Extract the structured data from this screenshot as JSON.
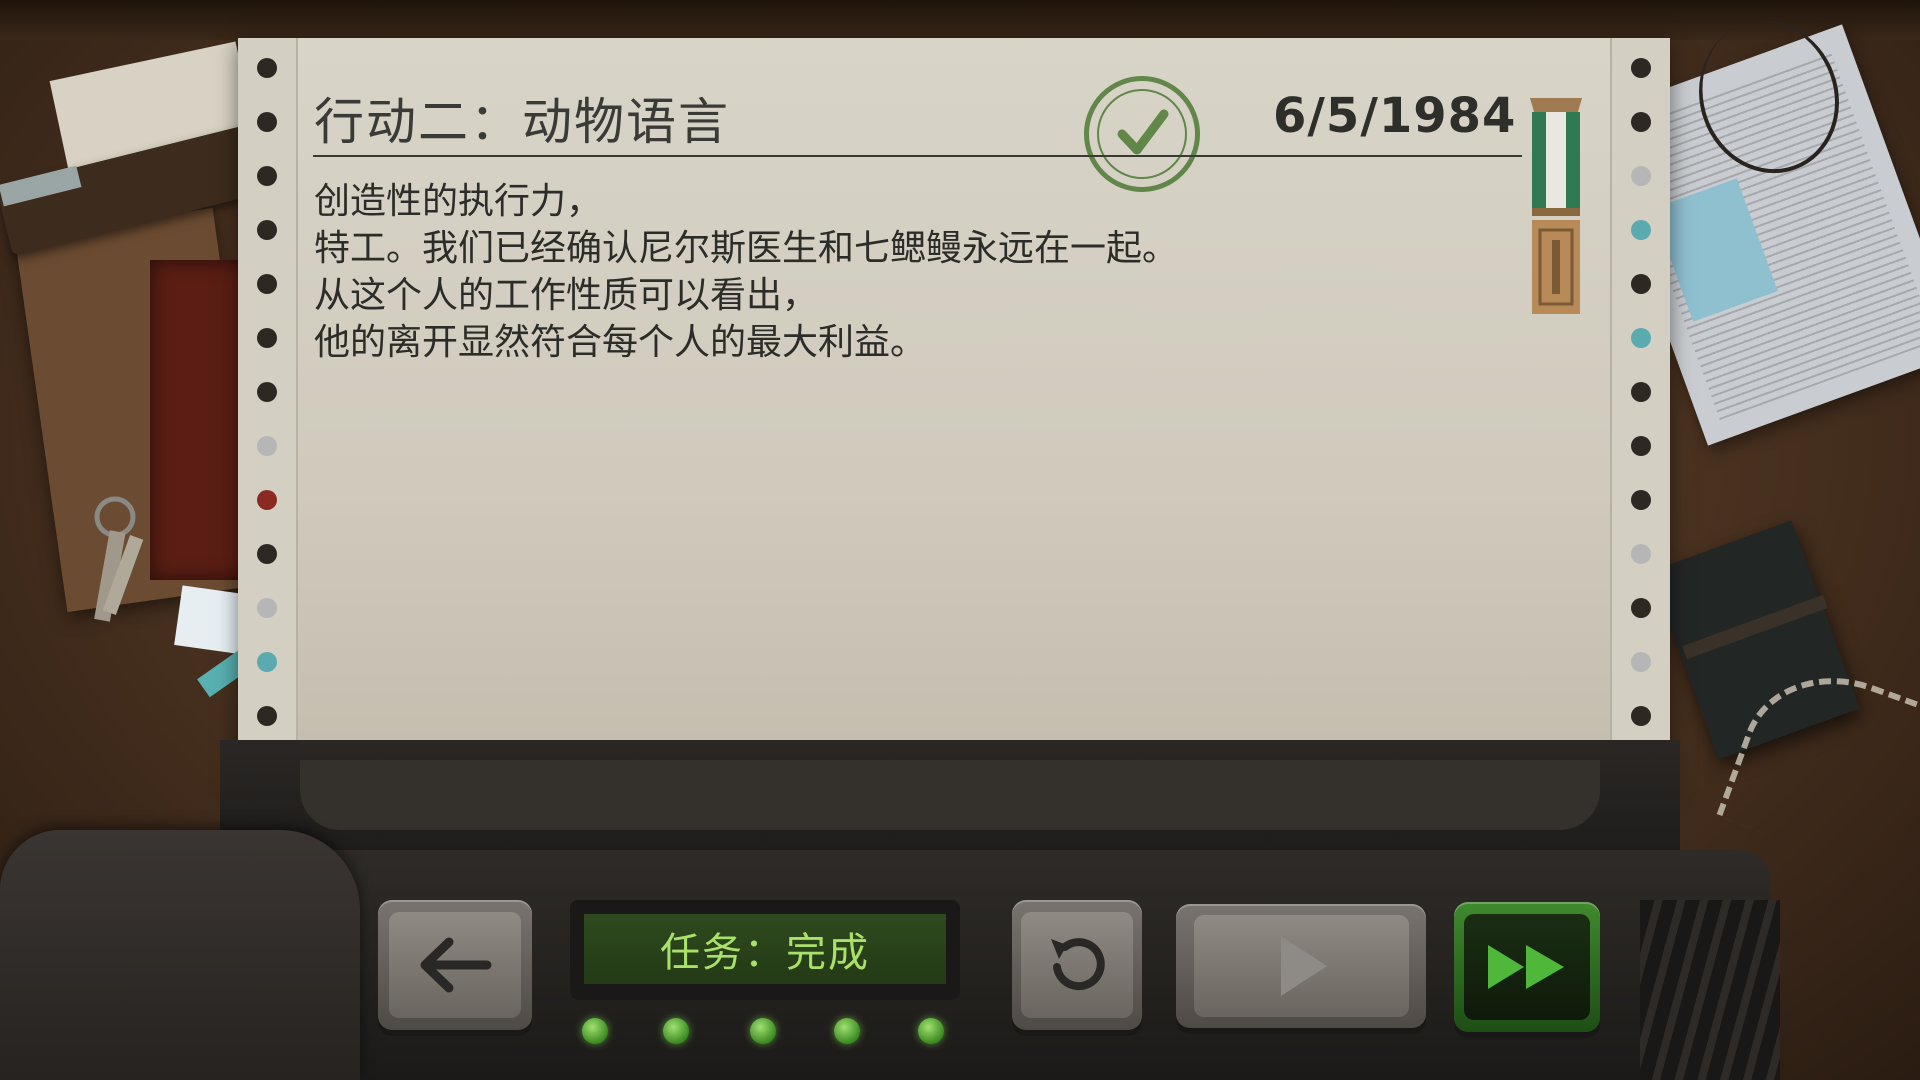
{
  "report": {
    "title": "行动二：动物语言",
    "date": "6/5/1984",
    "lines": [
      "创造性的执行力，",
      "特工。我们已经确认尼尔斯医生和七鳃鳗永远在一起。",
      "从这个人的工作性质可以看出，",
      "他的离开显然符合每个人的最大利益。"
    ],
    "stamp_icon": "checkmark-stamp-icon",
    "medal_icon": "medal-ribbon-icon"
  },
  "console": {
    "status_display": "任务：完成",
    "indicator_leds": 5,
    "led_color": "#7ccf4a",
    "buttons": {
      "back_icon": "arrow-left-icon",
      "restart_icon": "restart-icon",
      "play_icon": "play-icon",
      "fast_forward_icon": "fast-forward-icon"
    }
  },
  "colors": {
    "stamp": "#4d7a34",
    "lcd_text": "#a9e06a",
    "ff_button": "#3f8a2e"
  }
}
